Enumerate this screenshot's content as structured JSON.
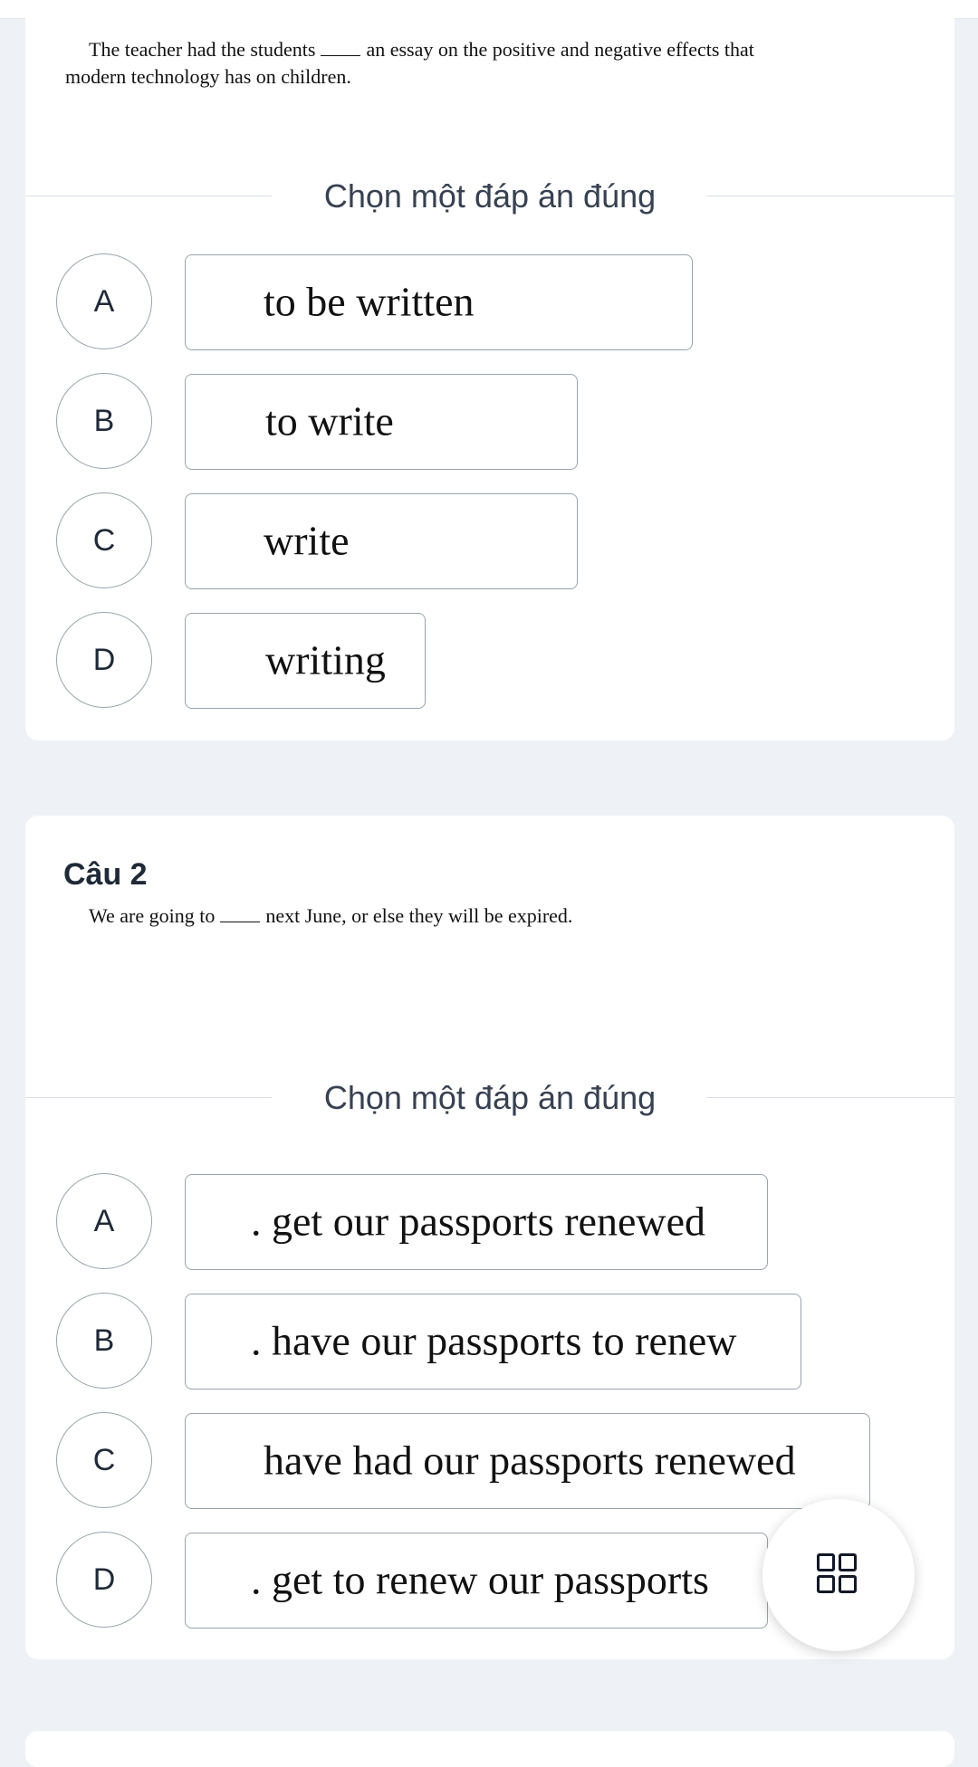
{
  "question1": {
    "text_before": "The teacher had the students",
    "text_after": "an essay on the positive and negative effects that",
    "text_line2": "modern technology has on children.",
    "prompt": "Chọn một đáp án đúng",
    "options": [
      {
        "letter": "A",
        "text": "to be written"
      },
      {
        "letter": "B",
        "text": "to write"
      },
      {
        "letter": "C",
        "text": "write"
      },
      {
        "letter": "D",
        "text": "writing"
      }
    ]
  },
  "question2": {
    "title": "Câu 2",
    "text_before": "We are going to",
    "text_after": "next June, or else they will be expired.",
    "prompt": "Chọn một đáp án đúng",
    "options": [
      {
        "letter": "A",
        "text": ". get our passports renewed"
      },
      {
        "letter": "B",
        "text": ". have our passports to renew"
      },
      {
        "letter": "C",
        "text": "have had our passports renewed"
      },
      {
        "letter": "D",
        "text": ". get to renew our passports"
      }
    ]
  },
  "fab": {
    "icon": "grid-icon"
  }
}
